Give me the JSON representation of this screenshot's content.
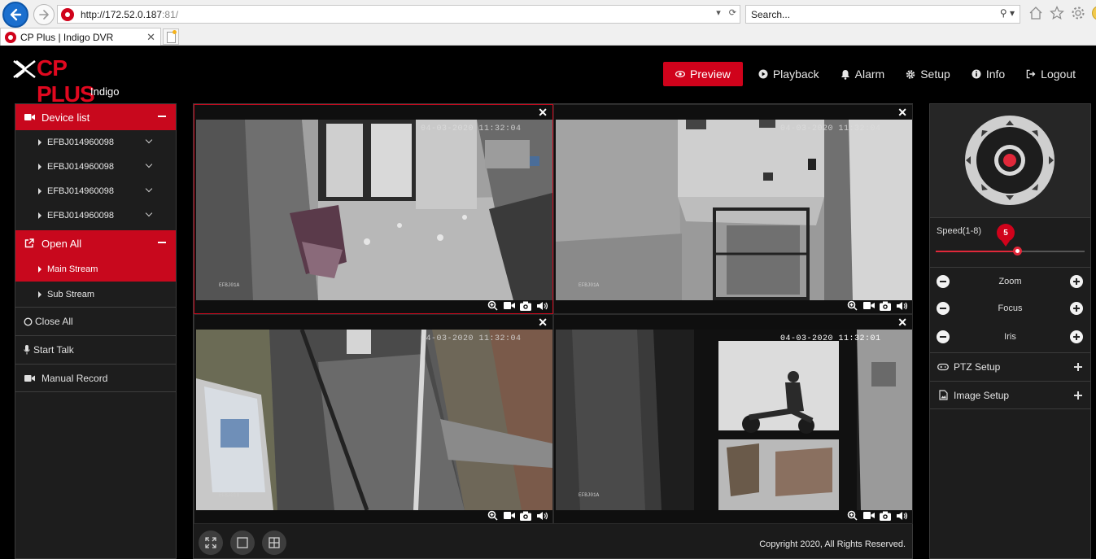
{
  "browser": {
    "url_host": "http://172.52.0.187",
    "url_port": ":81/",
    "search_placeholder": "Search...",
    "tab_title": "CP Plus | Indigo DVR"
  },
  "app": {
    "brand": "CP PLUS",
    "brand_sub": "Indigo",
    "nav": {
      "preview": "Preview",
      "playback": "Playback",
      "alarm": "Alarm",
      "setup": "Setup",
      "info": "Info",
      "logout": "Logout"
    },
    "accent_color": "#d0021b"
  },
  "sidebar": {
    "device_list": "Device list",
    "devices": [
      "EFBJ014960098",
      "EFBJ014960098",
      "EFBJ014960098",
      "EFBJ014960098"
    ],
    "open_all": "Open All",
    "main_stream": "Main Stream",
    "sub_stream": "Sub Stream",
    "close_all": "Close All",
    "start_talk": "Start Talk",
    "manual_record": "Manual Record"
  },
  "videos": {
    "cam1_ts": "04-03-2020 11:32:04",
    "cam2_ts": "04-03-2020 11:32:04",
    "cam3_ts": "04-03-2020 11:32:04",
    "cam4_ts": "04-03-2020 11:32:01",
    "cam1_label": "EFBJ01A",
    "cam2_label": "EFBJ01A",
    "cam3_label": "EFBJ01A",
    "cam4_label": "EFBJ01A",
    "selected_cell": 1
  },
  "footer": {
    "copyright": "Copyright 2020, All Rights Reserved."
  },
  "ptz": {
    "speed_label": "Speed(1-8)",
    "speed_value": "5",
    "speed_min": 1,
    "speed_max": 8,
    "zoom": "Zoom",
    "focus": "Focus",
    "iris": "Iris",
    "ptz_setup": "PTZ Setup",
    "image_setup": "Image Setup"
  }
}
